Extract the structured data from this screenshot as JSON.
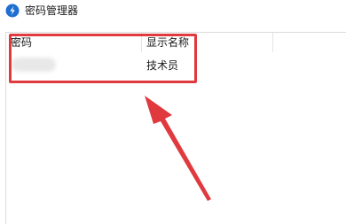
{
  "window": {
    "title": "密码管理器",
    "icon": "app-logo-icon"
  },
  "table": {
    "columns": [
      "密码",
      "显示名称"
    ],
    "rows": [
      {
        "password": "",
        "display_name": "技术员"
      }
    ]
  },
  "annotation": {
    "highlight_color": "#e03a3e",
    "arrow_color": "#e03a3e"
  }
}
